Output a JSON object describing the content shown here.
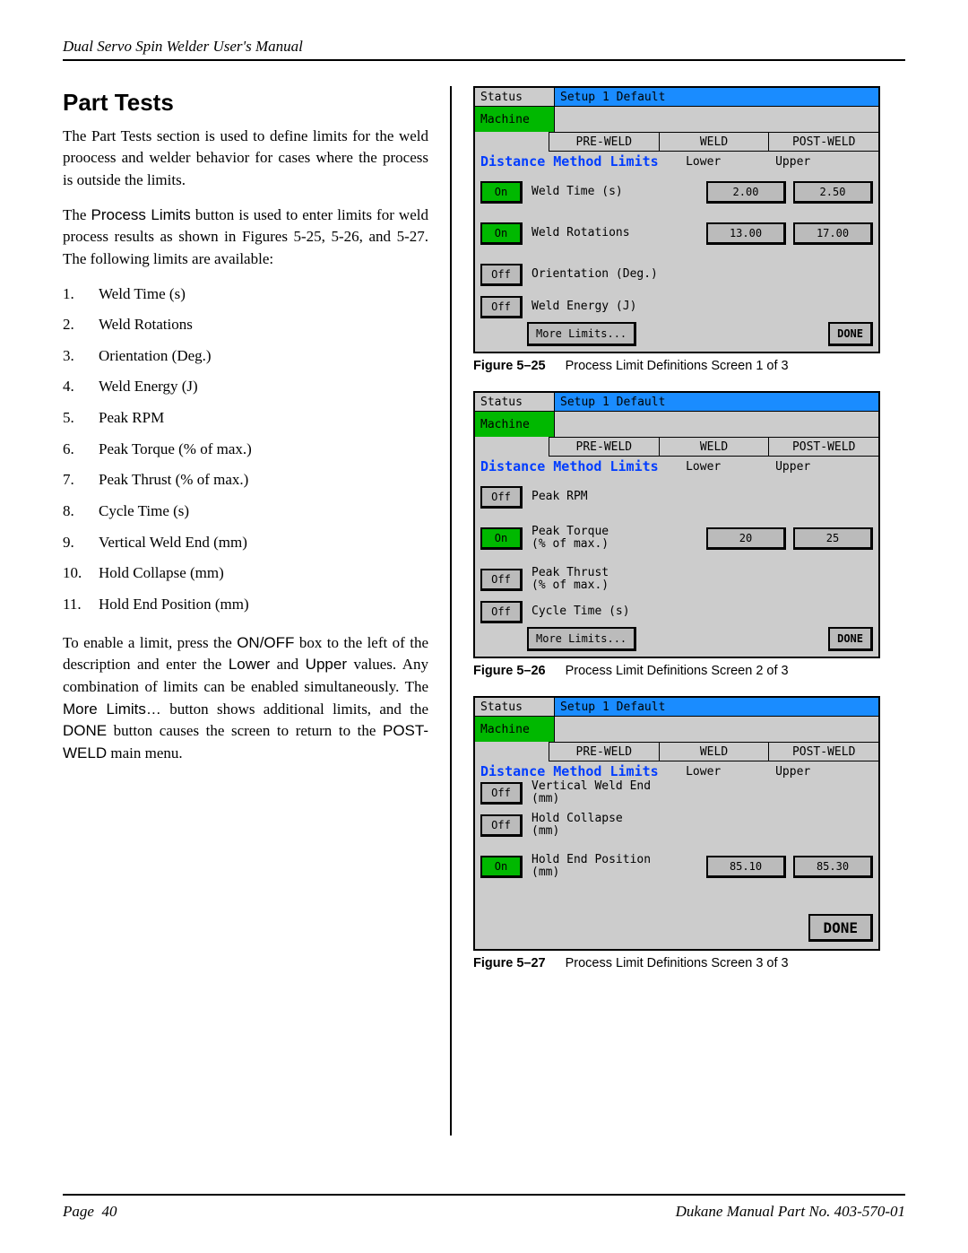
{
  "header": {
    "title": "Dual Servo Spin Welder User's Manual"
  },
  "left": {
    "section_title": "Part Tests",
    "para1": "The Part Tests section is used to define limits for the weld proocess and welder behavior for cases where the process is outside the limits.",
    "para2_a": "The ",
    "para2_b": "Process Limits",
    "para2_c": " button is used to enter limits for weld process results as shown in Figures 5-25, 5-26, and 5-27. The following limits are available:",
    "list": {
      "i1": "Weld Time (s)",
      "i2": "Weld Rotations",
      "i3": "Orientation (Deg.)",
      "i4": "Weld Energy (J)",
      "i5": "Peak RPM",
      "i6": "Peak Torque (% of max.)",
      "i7": "Peak Thrust (% of max.)",
      "i8": "Cycle Time (s)",
      "i9": "Vertical Weld End (mm)",
      "i10": "Hold Collapse (mm)",
      "i11": "Hold End Position (mm)"
    },
    "para3_a": "To enable a limit, press the ",
    "para3_b": "ON/OFF",
    "para3_c": " box to the left of the description and enter the ",
    "para3_d": "Lower",
    "para3_e": " and ",
    "para3_f": "Upper",
    "para3_g": " values. Any combination of limits can be enabled simultaneously. The ",
    "para3_h": "More Limits…",
    "para3_i": " button shows additional limits, and the ",
    "para3_j": "DONE",
    "para3_k": " button causes the screen to return to the ",
    "para3_l": "POST-WELD",
    "para3_m": " main menu."
  },
  "common": {
    "status": "Status",
    "setup": "Setup 1    Default",
    "machine": "Machine",
    "pre_weld": "PRE-WELD",
    "weld": "WELD",
    "post_weld": "POST-WELD",
    "heading": "Distance Method Limits",
    "lower": "Lower",
    "upper": "Upper",
    "on": "On",
    "off": "Off",
    "more": "More Limits...",
    "done": "DONE"
  },
  "fig25": {
    "rows": {
      "r1": {
        "state": "On",
        "label": "Weld Time (s)",
        "lower": "2.00",
        "upper": "2.50"
      },
      "r2": {
        "state": "On",
        "label": "Weld Rotations",
        "lower": "13.00",
        "upper": "17.00"
      },
      "r3": {
        "state": "Off",
        "label": "Orientation (Deg.)"
      },
      "r4": {
        "state": "Off",
        "label": "Weld Energy (J)"
      }
    },
    "caption_label": "Figure 5–25",
    "caption_text": "Process Limit Definitions Screen 1 of 3"
  },
  "fig26": {
    "rows": {
      "r1": {
        "state": "Off",
        "label": "Peak RPM"
      },
      "r2": {
        "state": "On",
        "label": "Peak Torque\n(% of max.)",
        "lower": "20",
        "upper": "25"
      },
      "r3": {
        "state": "Off",
        "label": "Peak Thrust\n(% of max.)"
      },
      "r4": {
        "state": "Off",
        "label": "Cycle Time (s)"
      }
    },
    "caption_label": "Figure 5–26",
    "caption_text": "Process Limit Definitions Screen 2 of 3"
  },
  "fig27": {
    "rows": {
      "r1": {
        "state": "Off",
        "label": "Vertical Weld End\n(mm)"
      },
      "r2": {
        "state": "Off",
        "label": "Hold Collapse\n(mm)"
      },
      "r3": {
        "state": "On",
        "label": "Hold End Position\n(mm)",
        "lower": "85.10",
        "upper": "85.30"
      }
    },
    "caption_label": "Figure 5–27",
    "caption_text": "Process Limit Definitions Screen 3 of 3"
  },
  "footer": {
    "page_label": "Page",
    "page_num": "40",
    "manual": "Dukane Manual Part No. 403-570-01"
  }
}
